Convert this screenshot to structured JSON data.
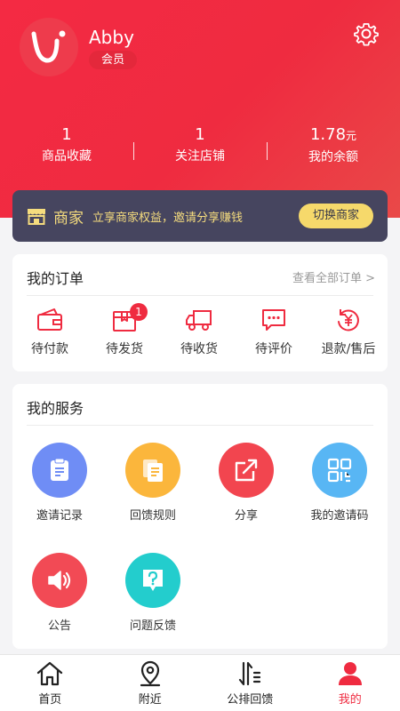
{
  "profile": {
    "name": "Abby",
    "badge": "会员"
  },
  "stats": [
    {
      "value": "1",
      "label": "商品收藏"
    },
    {
      "value": "1",
      "label": "关注店铺"
    },
    {
      "value": "1.78",
      "unit": "元",
      "label": "我的余额"
    }
  ],
  "merchant": {
    "title": "商家",
    "desc": "立享商家权益，邀请分享赚钱",
    "button": "切换商家"
  },
  "orders": {
    "title": "我的订单",
    "view_all": "查看全部订单 >",
    "items": [
      {
        "label": "待付款",
        "icon": "wallet-icon"
      },
      {
        "label": "待发货",
        "icon": "package-icon",
        "badge": "1"
      },
      {
        "label": "待收货",
        "icon": "truck-icon"
      },
      {
        "label": "待评价",
        "icon": "comment-icon"
      },
      {
        "label": "退款/售后",
        "icon": "refund-icon"
      }
    ]
  },
  "services": {
    "title": "我的服务",
    "items": [
      {
        "label": "邀请记录",
        "icon": "record-icon",
        "color": "#6f8df5"
      },
      {
        "label": "回馈规则",
        "icon": "rules-icon",
        "color": "#fbb63c"
      },
      {
        "label": "分享",
        "icon": "share-icon",
        "color": "#f2454f"
      },
      {
        "label": "我的邀请码",
        "icon": "qrcode-icon",
        "color": "#58b6f4"
      },
      {
        "label": "公告",
        "icon": "speaker-icon",
        "color": "#f24a55"
      },
      {
        "label": "问题反馈",
        "icon": "feedback-icon",
        "color": "#23cdcd"
      }
    ]
  },
  "tabs": [
    {
      "label": "首页",
      "icon": "home-icon"
    },
    {
      "label": "附近",
      "icon": "location-icon"
    },
    {
      "label": "公排回馈",
      "icon": "sort-icon"
    },
    {
      "label": "我的",
      "icon": "user-icon",
      "active": true
    }
  ],
  "colors": {
    "brand": "#ef2b40",
    "merchant_bg": "#46455f",
    "merchant_text": "#f5dc7e"
  }
}
